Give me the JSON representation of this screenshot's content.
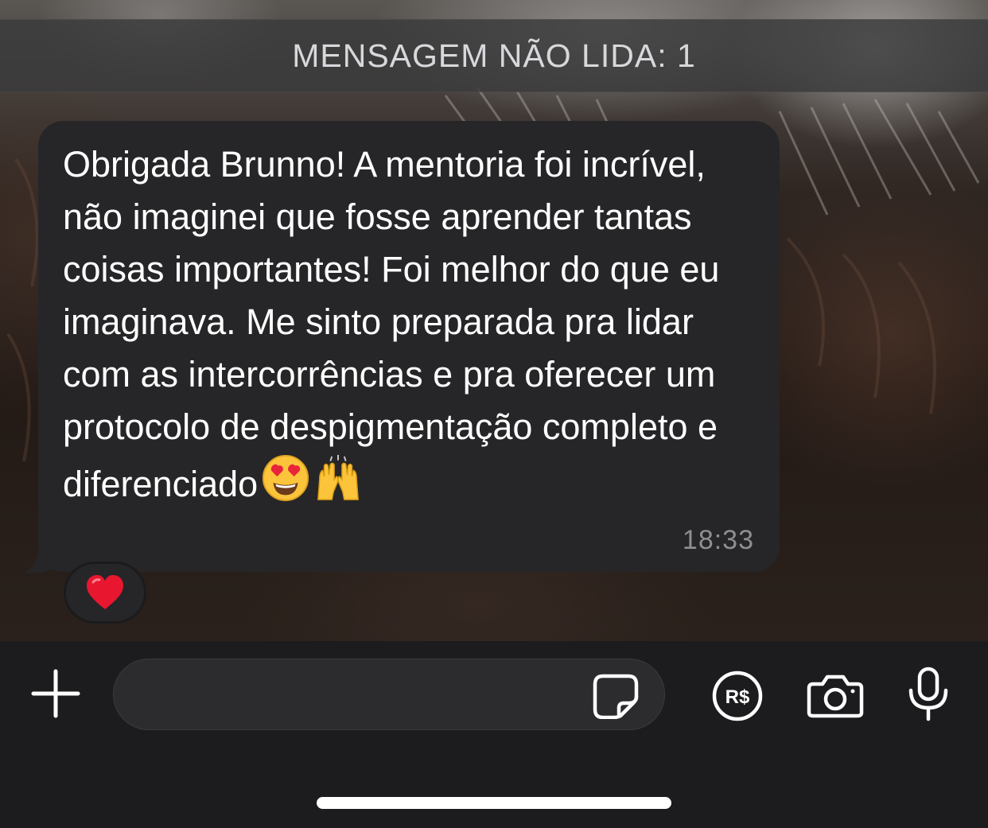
{
  "banner": {
    "unread_text": "MENSAGEM NÃO LIDA: 1"
  },
  "message": {
    "text": "Obrigada Brunno! A mentoria foi incrível, não imaginei que fosse aprender tantas coisas importantes! Foi melhor do que eu imaginava. Me sinto preparada pra lidar com as intercorrências e pra oferecer um protocolo de despigmentação completo e diferenciado",
    "emojis": [
      "heart-eyes-emoji",
      "raising-hands-emoji"
    ],
    "time": "18:33",
    "reaction": "red-heart-emoji"
  },
  "composer": {
    "input_value": "",
    "input_placeholder": "",
    "icons": [
      "plus-icon",
      "sticker-icon",
      "real-payment-icon",
      "camera-icon",
      "microphone-icon"
    ]
  },
  "colors": {
    "bubble": "#262628",
    "banner": "#3a3a3c",
    "composer": "#1c1c1e",
    "timestamp": "#8e8e93",
    "text": "#ffffff"
  }
}
